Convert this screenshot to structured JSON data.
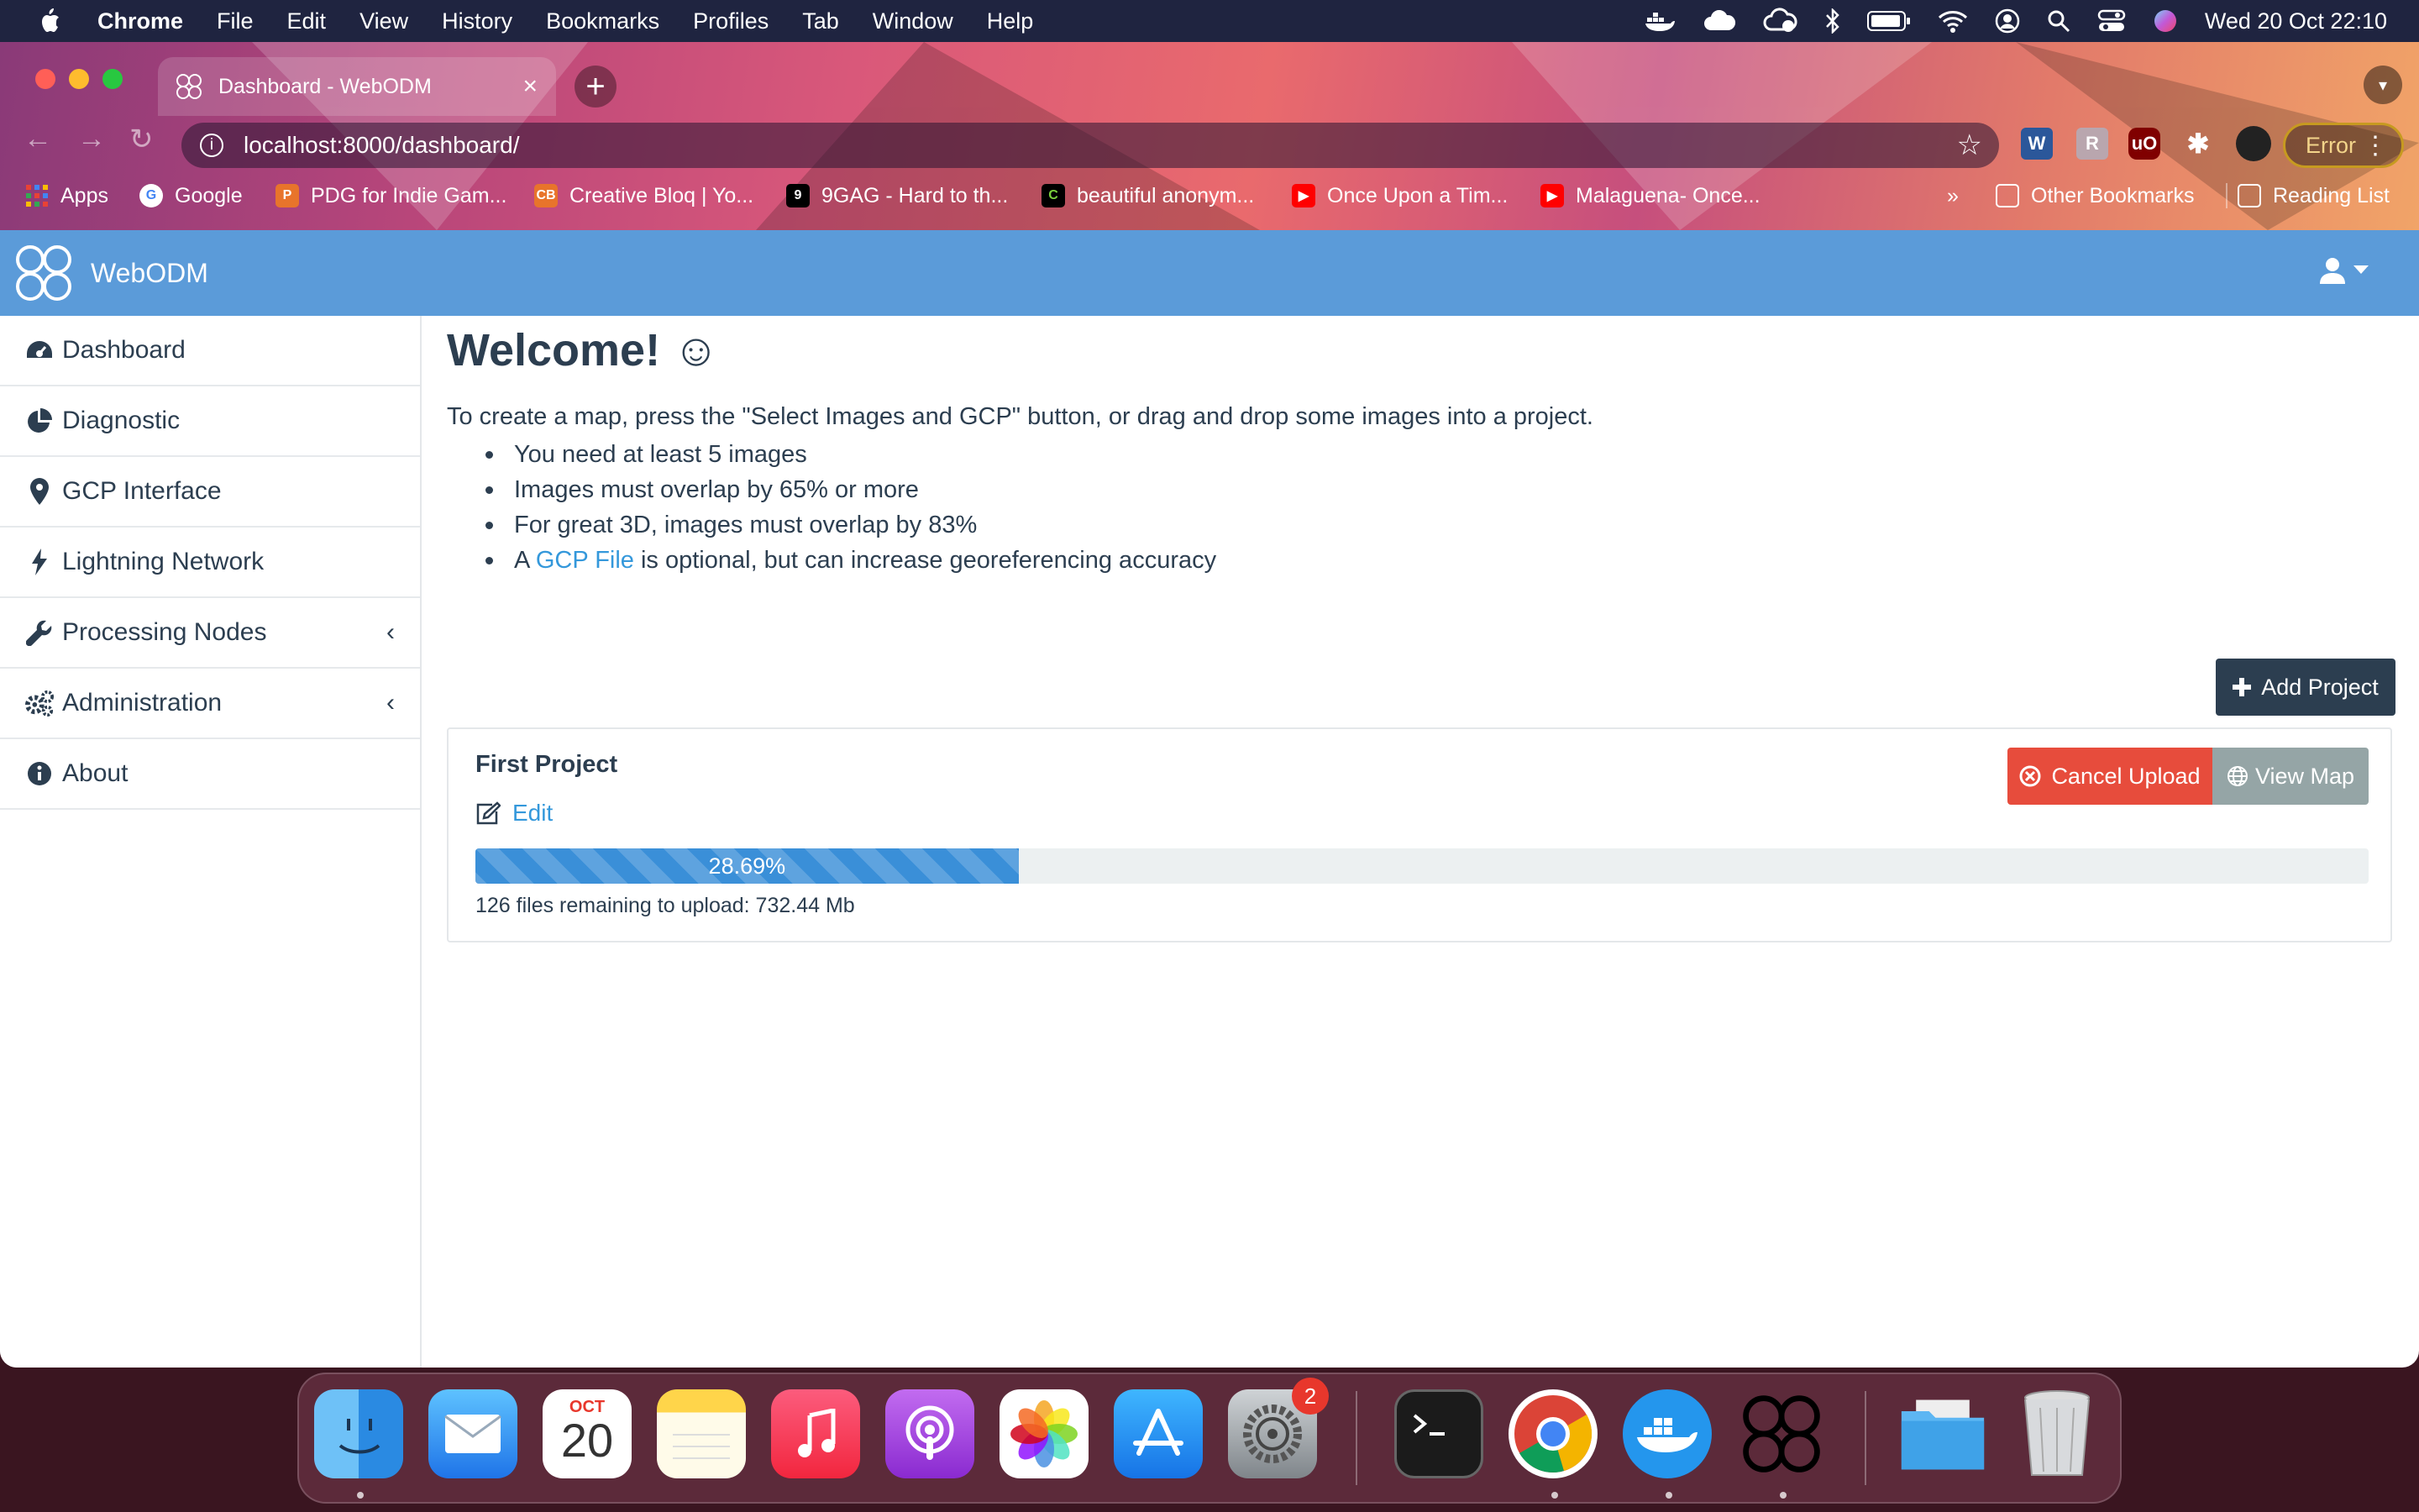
{
  "menubar": {
    "items": [
      "Chrome",
      "File",
      "Edit",
      "View",
      "History",
      "Bookmarks",
      "Profiles",
      "Tab",
      "Window",
      "Help"
    ],
    "clock": "Wed 20 Oct  22:10"
  },
  "browser": {
    "tab_title": "Dashboard - WebODM",
    "url": "localhost:8000/dashboard/",
    "error_label": "Error",
    "bookmarks": [
      "Apps",
      "Google",
      "PDG for Indie Gam...",
      "Creative Bloq | Yo...",
      "9GAG - Hard to th...",
      "beautiful anonym...",
      "Once Upon a Tim...",
      "Malaguena- Once...",
      "Other Bookmarks",
      "Reading List"
    ]
  },
  "app": {
    "brand": "WebODM",
    "sidebar": [
      {
        "label": "Dashboard",
        "icon": "dashboard-icon"
      },
      {
        "label": "Diagnostic",
        "icon": "pie-chart-icon"
      },
      {
        "label": "GCP Interface",
        "icon": "map-marker-icon"
      },
      {
        "label": "Lightning Network",
        "icon": "bolt-icon"
      },
      {
        "label": "Processing Nodes",
        "icon": "wrench-icon"
      },
      {
        "label": "Administration",
        "icon": "gears-icon"
      },
      {
        "label": "About",
        "icon": "info-icon"
      }
    ],
    "welcome": "Welcome! ☺",
    "intro": "To create a map, press the \"Select Images and GCP\" button, or drag and drop some images into a project.",
    "bullets": [
      "You need at least 5 images",
      "Images must overlap by 65% or more",
      "For great 3D, images must overlap by 83%"
    ],
    "bullet_gcp": {
      "prefix": "A ",
      "link": "GCP File",
      "suffix": " is optional, but can increase georeferencing accuracy"
    },
    "add_project": "Add Project",
    "project": {
      "name": "First Project",
      "edit": "Edit",
      "cancel_upload": "Cancel Upload",
      "view_map": "View Map",
      "progress": 28.69,
      "progress_label": "28.69%",
      "status": "126 files remaining to upload: 732.44 Mb"
    }
  },
  "dock": {
    "calendar_month": "OCT",
    "calendar_day": "20",
    "settings_badge": "2"
  },
  "colors": {
    "navbar": "#5b9bd9",
    "primary_dark": "#2c3e50",
    "danger": "#e74c3c",
    "muted_button": "#95a5a6",
    "link": "#3498db"
  }
}
